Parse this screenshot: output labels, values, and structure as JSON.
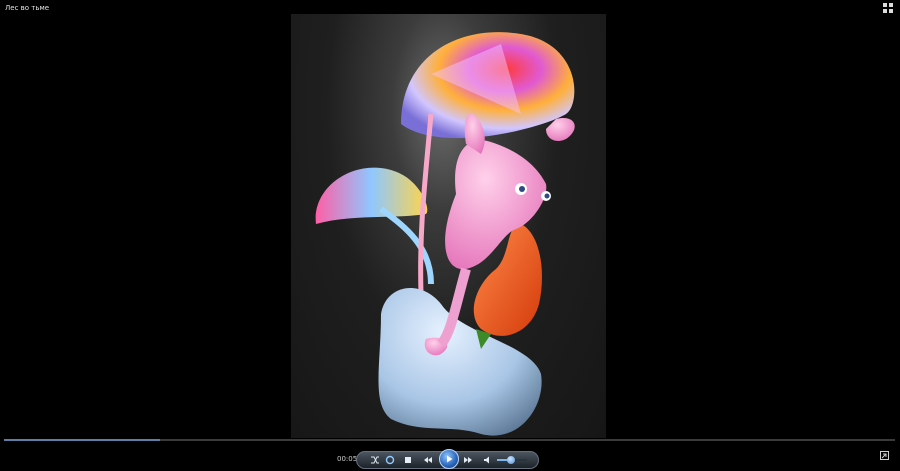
{
  "window": {
    "title": "Лес во тьме"
  },
  "player": {
    "time": "00:05",
    "progress_percent": 17.5,
    "volume_percent": 45
  },
  "colors": {
    "background": "#000000",
    "seek_fill": "#5c7fa6",
    "accent_blue": "#2a64b8"
  },
  "icons": {
    "view_switch": "view-switch-icon",
    "shuffle": "shuffle-icon",
    "repeat": "repeat-icon",
    "stop": "stop-icon",
    "previous": "previous-icon",
    "play": "play-icon",
    "next": "next-icon",
    "mute": "speaker-icon",
    "restore": "restore-icon"
  }
}
